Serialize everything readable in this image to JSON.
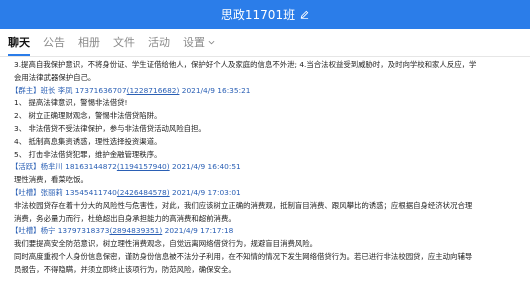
{
  "window": {
    "title": "思政11701班"
  },
  "tabs": [
    {
      "label": "聊天",
      "active": true
    },
    {
      "label": "公告",
      "active": false
    },
    {
      "label": "相册",
      "active": false
    },
    {
      "label": "文件",
      "active": false
    },
    {
      "label": "活动",
      "active": false
    },
    {
      "label": "设置",
      "active": false,
      "has_dropdown": true
    }
  ],
  "messages": [
    {
      "header": null,
      "lines": [
        "3.提高自我保护意识，不将身份证、学生证借给他人，保护好个人及家庭的信息不外泄; 4.当合法权益受到威胁时，及时向学校和家人反应，学",
        "会用法律武器保护自己。"
      ]
    },
    {
      "header": {
        "role": "【群主】",
        "sender": "班长 李凤",
        "phone": "17371636707",
        "qq": "(1228716682)",
        "time": "2021/4/9 16:35:21"
      },
      "lines": [
        "1、 提高法律意识，警惕非法借贷!",
        "2、 树立正确理财观念，警惕非法借贷陷阱。",
        "3、 非法借贷不受法律保护，参与非法借贷活动风险自担。",
        "4、 抵制高息集资诱惑，理性选择投资渠道。",
        "5、 打击非法借贷犯罪，维护金融管理秩序。"
      ]
    },
    {
      "header": {
        "role": "【活跃】",
        "sender": "杨芈川",
        "phone": "18163144872",
        "qq": "(1194157940)",
        "time": "2021/4/9 16:40:51"
      },
      "lines": [
        "理性消费，看菜吃饭。"
      ]
    },
    {
      "header": {
        "role": "【吐槽】",
        "sender": "张丽莉",
        "phone": "13545411740",
        "qq": "(2426484578)",
        "time": "2021/4/9 17:03:01"
      },
      "lines": [
        "非法校园贷存在着十分大的风险性与危害性，对此，我们应该树立正确的消费观，抵制盲目消费、跟风攀比的诱惑；应根据自身经济状况合理",
        "消费，务必量力而行，杜绝超出自身承担能力的高消费和超前消费。"
      ]
    },
    {
      "header": {
        "role": "【吐槽】",
        "sender": "杨宁",
        "phone": "13797318373",
        "qq": "(2894839351)",
        "time": "2021/4/9 17:17:18"
      },
      "lines": [
        "我们要提高安全防范意识，树立理性消费观念，自觉远离网络借贷行为，规避盲目消费风险。",
        "同时高度重视个人身份信息保密，谨防身份信息被不法分子利用，在不知情的情况下发生网络借贷行为。若已进行非法校园贷，应主动向辅导",
        "员报告，不得隐瞒，并须立即终止该项行为，防范风险，确保安全。"
      ]
    }
  ]
}
